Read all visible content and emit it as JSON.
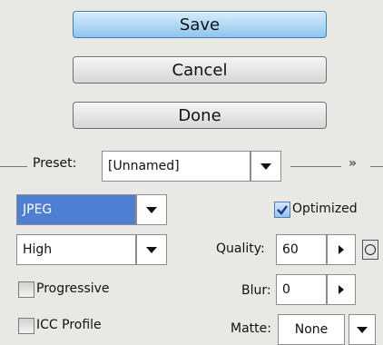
{
  "buttons": {
    "save": "Save",
    "cancel": "Cancel",
    "done": "Done"
  },
  "preset": {
    "label": "Preset:",
    "value": "[Unnamed]",
    "menu_glyph": "»"
  },
  "format": {
    "value": "JPEG"
  },
  "compression": {
    "value": "High"
  },
  "optimized": {
    "label": "Optimized",
    "checked": true
  },
  "quality": {
    "label": "Quality:",
    "value": "60"
  },
  "progressive": {
    "label": "Progressive",
    "checked": false
  },
  "blur": {
    "label": "Blur:",
    "value": "0"
  },
  "icc_profile": {
    "label": "ICC Profile",
    "checked": false
  },
  "matte": {
    "label": "Matte:",
    "value": "None"
  },
  "colors": {
    "selected_field": "#4f7fd3",
    "primary_button": "#8fc6ee",
    "background": "#e8e8e4"
  }
}
